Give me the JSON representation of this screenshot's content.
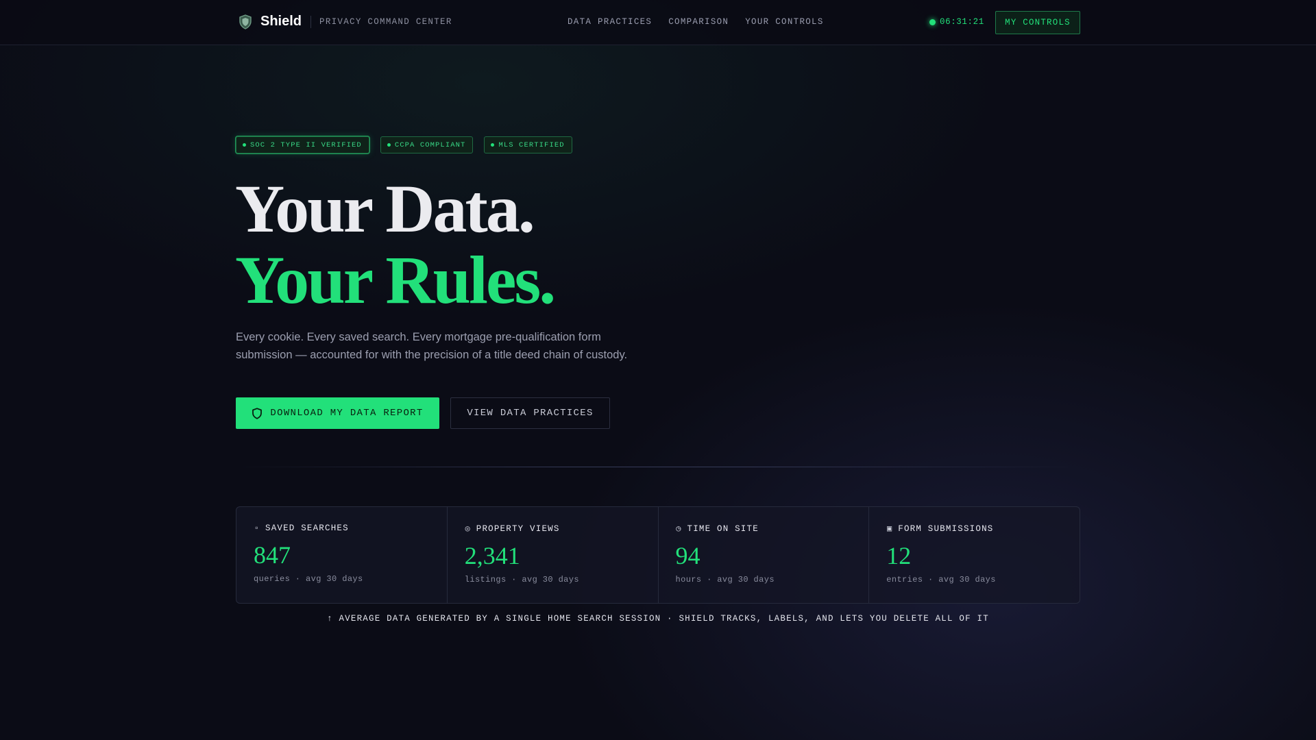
{
  "header": {
    "brand_name": "Shield",
    "brand_icon": "shield-icon",
    "brand_subtitle": "PRIVACY COMMAND CENTER",
    "nav": [
      "DATA PRACTICES",
      "COMPARISON",
      "YOUR CONTROLS"
    ],
    "clock_time": "06:31:21",
    "cta_label": "MY CONTROLS"
  },
  "badges": [
    "SOC 2 TYPE II VERIFIED",
    "CCPA COMPLIANT",
    "MLS CERTIFIED"
  ],
  "hero": {
    "line1": "Your Data.",
    "line2": "Your Rules.",
    "description": "Every cookie. Every saved search. Every mortgage pre-qualification form submission — accounted for with the precision of a title deed chain of custody."
  },
  "actions": {
    "primary_label": "DOWNLOAD MY DATA REPORT",
    "primary_icon": "shield-icon",
    "secondary_label": "VIEW DATA PRACTICES"
  },
  "stats": [
    {
      "icon": "▫",
      "label": "SAVED SEARCHES",
      "value": "847",
      "sub": "queries · avg 30 days"
    },
    {
      "icon": "◎",
      "label": "PROPERTY VIEWS",
      "value": "2,341",
      "sub": "listings · avg 30 days"
    },
    {
      "icon": "◷",
      "label": "TIME ON SITE",
      "value": "94",
      "sub": "hours · avg 30 days"
    },
    {
      "icon": "▣",
      "label": "FORM SUBMISSIONS",
      "value": "12",
      "sub": "entries · avg 30 days"
    }
  ],
  "caption": "↑ AVERAGE DATA GENERATED BY A SINGLE HOME SEARCH SESSION · SHIELD TRACKS, LABELS, AND LETS YOU DELETE ALL OF IT",
  "colors": {
    "accent": "#22e07a",
    "background": "#0b0c16",
    "panel": "#141526"
  }
}
